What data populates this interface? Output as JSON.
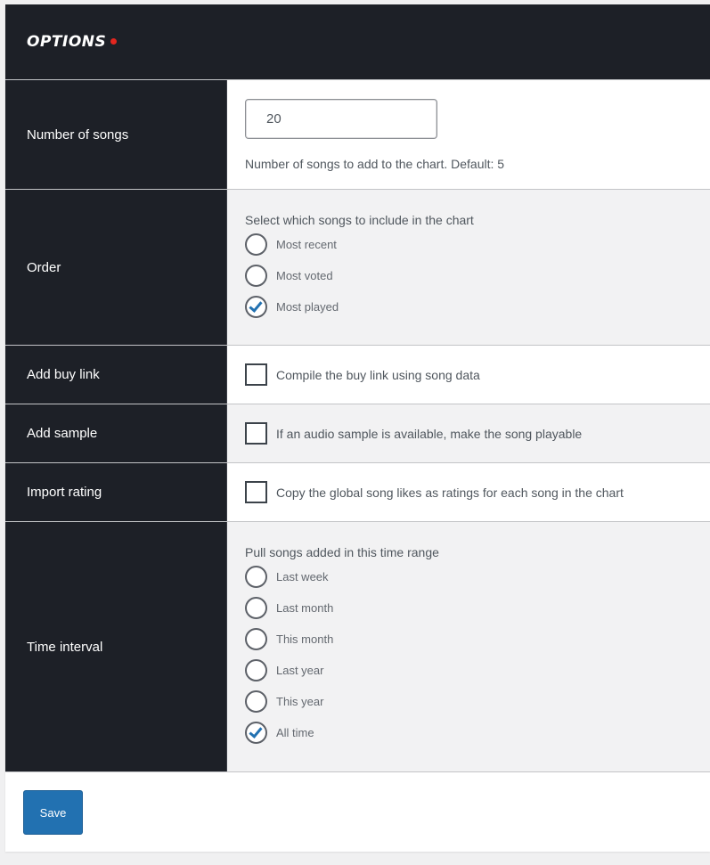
{
  "header": {
    "title": "OPTIONS"
  },
  "colors": {
    "accent": "#2271b1",
    "dark": "#1d2027",
    "dot": "#e3261f"
  },
  "number_of_songs": {
    "label": "Number of songs",
    "value": "20",
    "description": "Number of songs to add to the chart. Default: 5"
  },
  "order": {
    "label": "Order",
    "title": "Select which songs to include in the chart",
    "options": [
      {
        "label": "Most recent",
        "checked": false
      },
      {
        "label": "Most voted",
        "checked": false
      },
      {
        "label": "Most played",
        "checked": true
      }
    ]
  },
  "buy_link": {
    "label": "Add buy link",
    "checkbox_label": "Compile the buy link using song data",
    "checked": false
  },
  "sample": {
    "label": "Add sample",
    "checkbox_label": "If an audio sample is available, make the song playable",
    "checked": false
  },
  "rating": {
    "label": "Import rating",
    "checkbox_label": "Copy the global song likes as ratings for each song in the chart",
    "checked": false
  },
  "time_interval": {
    "label": "Time interval",
    "title": "Pull songs added in this time range",
    "options": [
      {
        "label": "Last week",
        "checked": false
      },
      {
        "label": "Last month",
        "checked": false
      },
      {
        "label": "This month",
        "checked": false
      },
      {
        "label": "Last year",
        "checked": false
      },
      {
        "label": "This year",
        "checked": false
      },
      {
        "label": "All time",
        "checked": true
      }
    ]
  },
  "footer": {
    "save_label": "Save"
  }
}
